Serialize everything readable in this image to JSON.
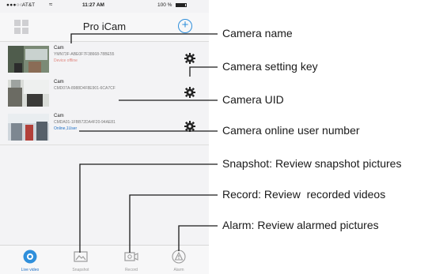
{
  "statusbar": {
    "signal": "●●●○○",
    "carrier": "AT&T",
    "time": "11:27 AM",
    "battery": "100 %"
  },
  "header": {
    "title": "Pro iCam"
  },
  "cameras": [
    {
      "name": "Cam",
      "uid": "YMN73F-ABE0F7F38668-78BE55",
      "status": "Device offline",
      "online": false
    },
    {
      "name": "Cam",
      "uid": "CMD07A-8988D4F8E901-6CA7CF",
      "status": "",
      "online": true
    },
    {
      "name": "Cam",
      "uid": "CMDA01-1FBB72DA4F20-94AE81",
      "status": "Online,1User",
      "online": true
    }
  ],
  "tabs": [
    {
      "label": "Live video",
      "icon": "live-video-icon",
      "active": true
    },
    {
      "label": "Snapshot",
      "icon": "snapshot-icon",
      "active": false
    },
    {
      "label": "Record",
      "icon": "record-icon",
      "active": false
    },
    {
      "label": "Alarm",
      "icon": "alarm-icon",
      "active": false
    }
  ],
  "annotations": {
    "camera_name": "Camera name",
    "camera_setting_key": "Camera setting key",
    "camera_uid": "Camera UID",
    "camera_online_user_number": "Camera online user number",
    "snapshot": "Snapshot: Review snapshot pictures",
    "record": "Record: Review  recorded videos",
    "alarm": "Alarm: Review alarmed pictures"
  },
  "colors": {
    "accent": "#2f8fdb",
    "online_text": "#1f6fc4"
  }
}
